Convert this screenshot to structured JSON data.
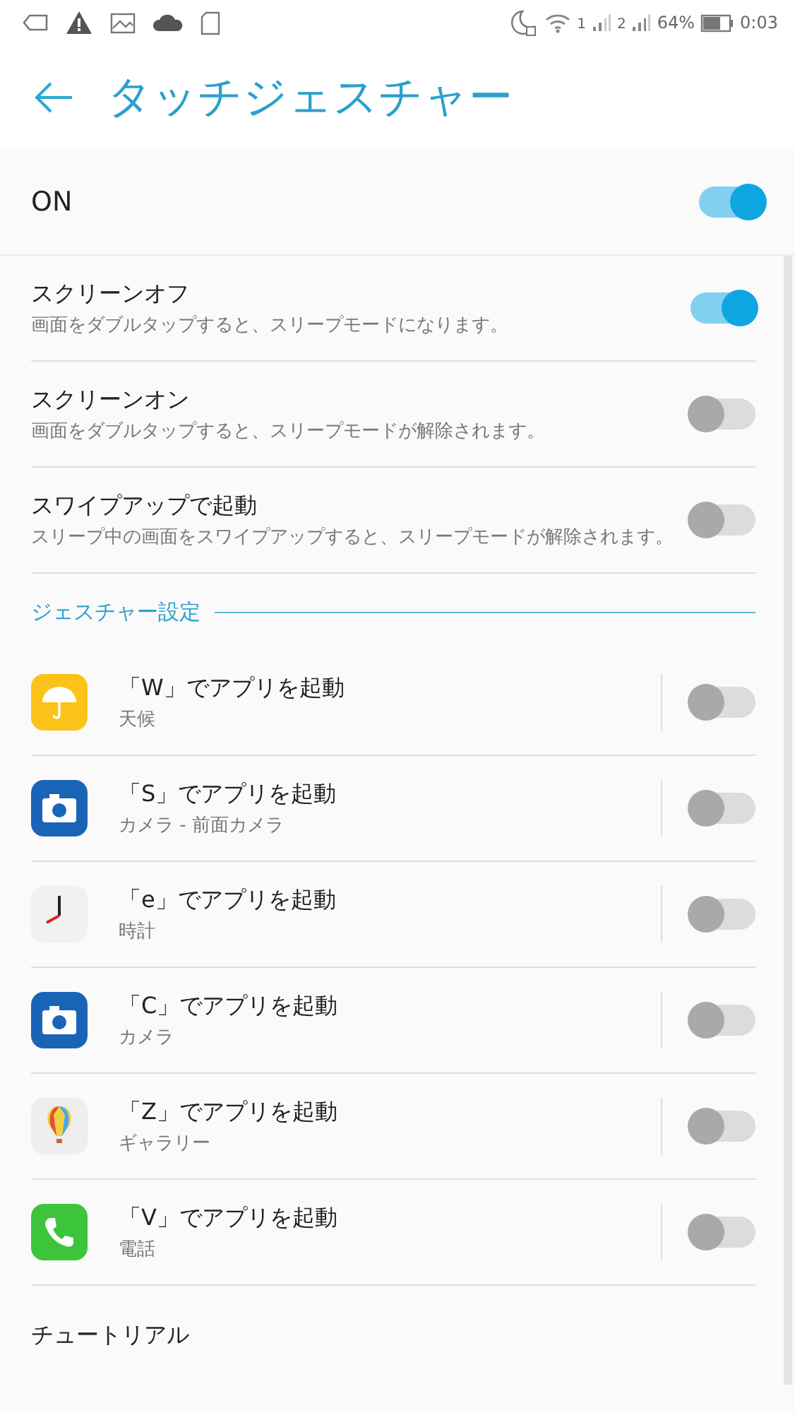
{
  "status_bar": {
    "sim_1": "1",
    "sim_2": "2",
    "battery": "64%",
    "time": "0:03"
  },
  "header": {
    "title": "タッチジェスチャー"
  },
  "master": {
    "label": "ON",
    "on": true
  },
  "settings": [
    {
      "title": "スクリーンオフ",
      "subtitle": "画面をダブルタップすると、スリープモードになります。",
      "on": true
    },
    {
      "title": "スクリーンオン",
      "subtitle": "画面をダブルタップすると、スリープモードが解除されます。",
      "on": false
    },
    {
      "title": "スワイプアップで起動",
      "subtitle": "スリープ中の画面をスワイプアップすると、スリープモードが解除されます。",
      "on": false
    }
  ],
  "section": {
    "title": "ジェスチャー設定"
  },
  "gestures": [
    {
      "kind": "weather",
      "title": "「W」でアプリを起動",
      "subtitle": "天候",
      "on": false
    },
    {
      "kind": "camera",
      "title": "「S」でアプリを起動",
      "subtitle": "カメラ - 前面カメラ",
      "on": false
    },
    {
      "kind": "clock",
      "title": "「e」でアプリを起動",
      "subtitle": "時計",
      "on": false
    },
    {
      "kind": "camera",
      "title": "「C」でアプリを起動",
      "subtitle": "カメラ",
      "on": false
    },
    {
      "kind": "gallery",
      "title": "「Z」でアプリを起動",
      "subtitle": "ギャラリー",
      "on": false
    },
    {
      "kind": "phone",
      "title": "「V」でアプリを起動",
      "subtitle": "電話",
      "on": false
    }
  ],
  "tutorial": {
    "label": "チュートリアル"
  }
}
